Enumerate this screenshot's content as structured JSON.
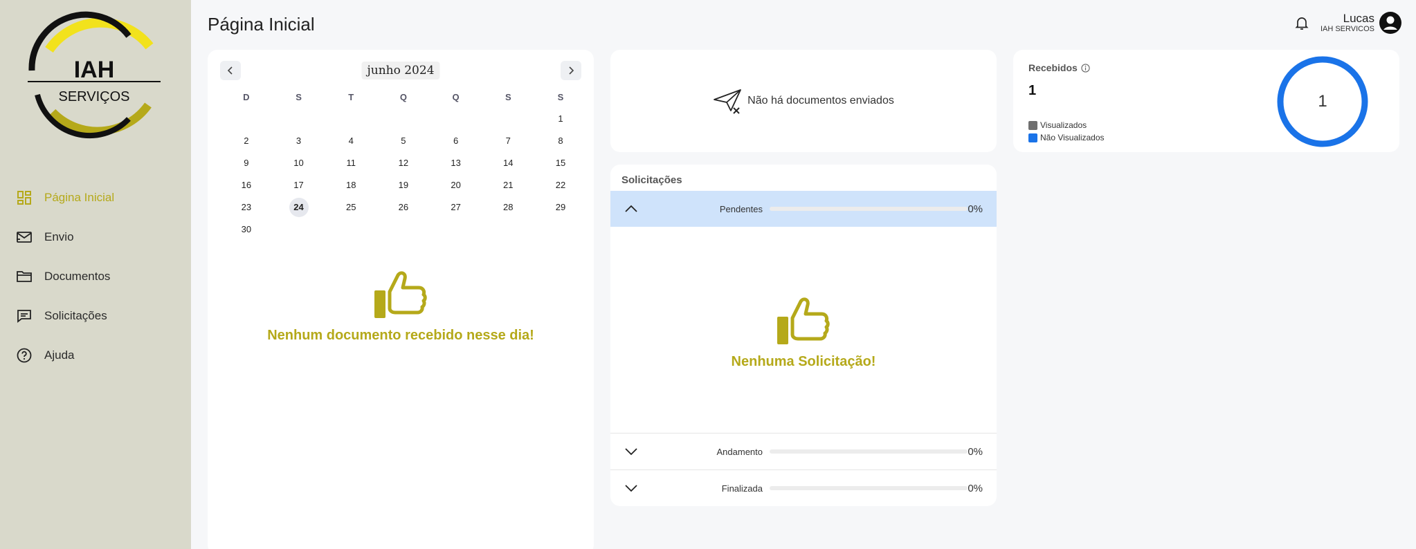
{
  "brand": {
    "logo_text_top": "IAH",
    "logo_text_bottom": "SERVIÇOS",
    "accent": "#b5a91a"
  },
  "sidebar": {
    "items": [
      {
        "label": "Página Inicial",
        "icon": "dashboard-icon",
        "active": true
      },
      {
        "label": "Envio",
        "icon": "mail-send-icon",
        "active": false
      },
      {
        "label": "Documentos",
        "icon": "folder-icon",
        "active": false
      },
      {
        "label": "Solicitações",
        "icon": "chat-icon",
        "active": false
      },
      {
        "label": "Ajuda",
        "icon": "help-icon",
        "active": false
      }
    ]
  },
  "header": {
    "title": "Página Inicial",
    "user_name": "Lucas",
    "user_company": "IAH SERVICOS"
  },
  "calendar": {
    "month_label": "junho 2024",
    "weekdays": [
      "D",
      "S",
      "T",
      "Q",
      "Q",
      "S",
      "S"
    ],
    "weeks": [
      [
        "",
        "",
        "",
        "",
        "",
        "",
        "1"
      ],
      [
        "2",
        "3",
        "4",
        "5",
        "6",
        "7",
        "8"
      ],
      [
        "9",
        "10",
        "11",
        "12",
        "13",
        "14",
        "15"
      ],
      [
        "16",
        "17",
        "18",
        "19",
        "20",
        "21",
        "22"
      ],
      [
        "23",
        "24",
        "25",
        "26",
        "27",
        "28",
        "29"
      ],
      [
        "30",
        "",
        "",
        "",
        "",
        "",
        ""
      ]
    ],
    "selected_day": "24",
    "empty_message": "Nenhum documento recebido nesse dia!"
  },
  "sent": {
    "message": "Não há documentos enviados"
  },
  "requests": {
    "title": "Solicitações",
    "groups": [
      {
        "label": "Pendentes",
        "percent": "0%",
        "progress": 0,
        "expanded": true
      },
      {
        "label": "Andamento",
        "percent": "0%",
        "progress": 0,
        "expanded": false
      },
      {
        "label": "Finalizada",
        "percent": "0%",
        "progress": 0,
        "expanded": false
      }
    ],
    "empty_message": "Nenhuma Solicitação!"
  },
  "received": {
    "title": "Recebidos",
    "count": "1",
    "legend": [
      {
        "label": "Visualizados",
        "color": "#6f6f6f"
      },
      {
        "label": "Não Visualizados",
        "color": "#1a73e8"
      }
    ],
    "donut_value": "1",
    "viewed": 0,
    "not_viewed": 1
  }
}
